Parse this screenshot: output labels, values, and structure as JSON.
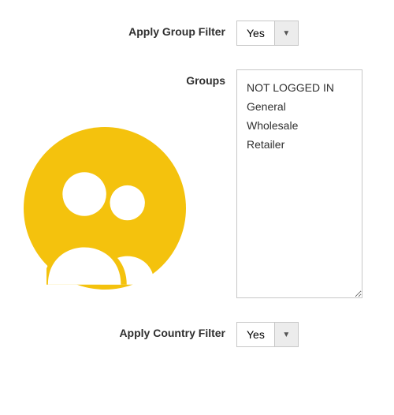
{
  "colors": {
    "accent": "#f4c20d",
    "border": "#c7c7c7",
    "arrowBg": "#ececec",
    "text": "#2f2f2f"
  },
  "icon": {
    "name": "users-icon"
  },
  "rows": {
    "groupFilter": {
      "label": "Apply Group Filter",
      "value": "Yes"
    },
    "groups": {
      "label": "Groups",
      "options": [
        "NOT LOGGED IN",
        "General",
        "Wholesale",
        "Retailer"
      ]
    },
    "countryFilter": {
      "label": "Apply Country Filter",
      "value": "Yes"
    }
  }
}
